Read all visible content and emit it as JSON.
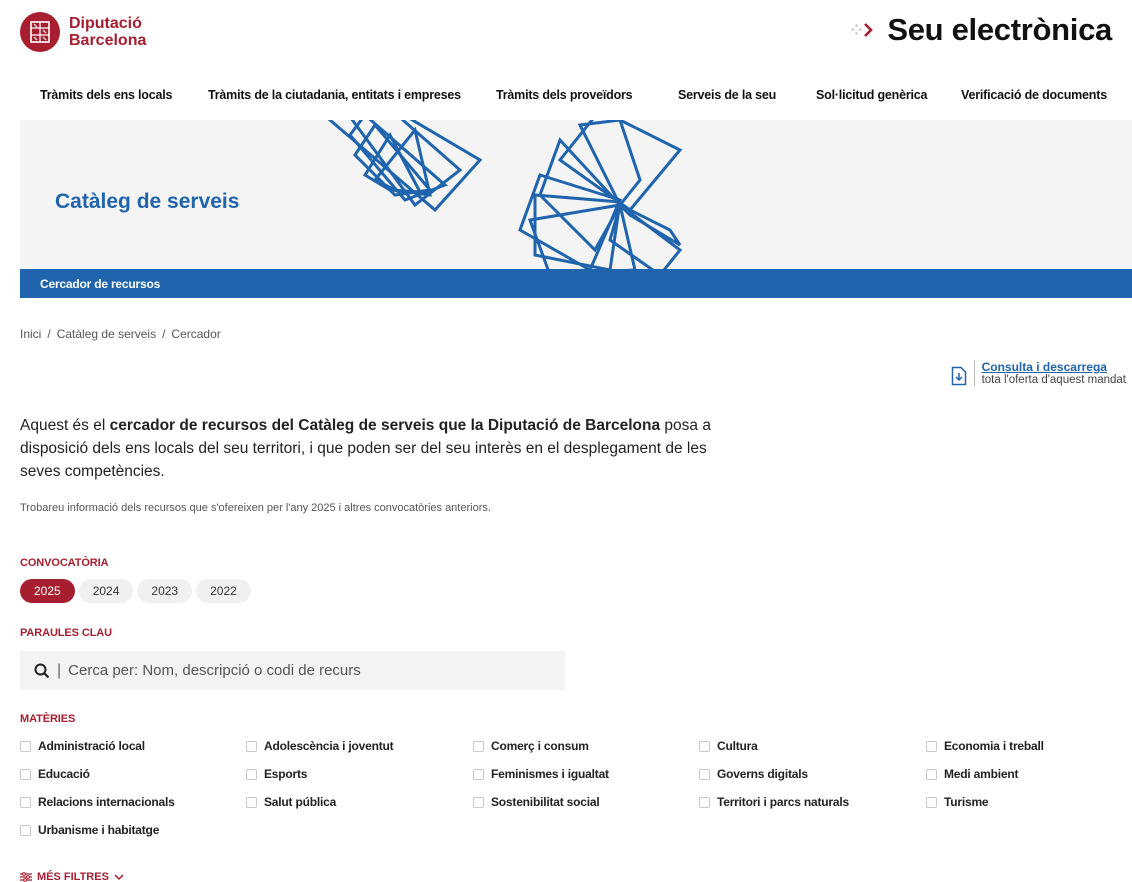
{
  "brand": {
    "line1": "Diputació",
    "line2": "Barcelona"
  },
  "seu": {
    "dots": "⁘",
    "title": "Seu electrònica"
  },
  "nav": [
    "Tràmits dels ens locals",
    "Tràmits de la ciutadania, entitats i empreses",
    "Tràmits dels proveïdors",
    "Serveis de la seu",
    "Sol·licitud genèrica",
    "Verificació de documents"
  ],
  "hero": {
    "title": "Catàleg de serveis",
    "bar_label": "Cercador de recursos"
  },
  "breadcrumb": {
    "items": [
      "Inici",
      "Catàleg de serveis",
      "Cercador"
    ],
    "separator": "/"
  },
  "download": {
    "link": "Consulta i descarrega",
    "sub": "tota l'oferta d'aquest mandat"
  },
  "intro": {
    "p1": "Aquest és el ",
    "bold": "cercador de recursos del Catàleg de serveis que la Diputació de Barcelona",
    "p2": " posa a disposició dels ens locals del seu territori, i que poden ser del seu interès en el desplegament de les seves competències.",
    "note": "Trobareu informació dels recursos que s'ofereixen per l'any 2025 i altres convocatòries anteriors."
  },
  "filters": {
    "convocatoria_label": "CONVOCATÒRIA",
    "years": [
      "2025",
      "2024",
      "2023",
      "2022"
    ],
    "selected_year": "2025",
    "keywords_label": "PARAULES CLAU",
    "search_placeholder": "Cerca per: Nom, descripció o codi de recurs",
    "search_value": "",
    "materies_label": "MATÈRIES",
    "materies": [
      "Administració local",
      "Adolescència i joventut",
      "Comerç i consum",
      "Cultura",
      "Economia i treball",
      "Educació",
      "Esports",
      "Feminismes i igualtat",
      "Governs digitals",
      "Medi ambient",
      "Relacions internacionals",
      "Salut pública",
      "Sostenibilitat social",
      "Territori i parcs naturals",
      "Turisme",
      "Urbanisme i habitatge"
    ],
    "more_label": "MÉS FILTRES"
  },
  "colors": {
    "brand_red": "#a61e2f",
    "brand_blue": "#1f64ad",
    "hero_bg": "#f4f4f4"
  },
  "icons": [
    "seal-icon",
    "chevron-right-icon",
    "download-document-icon",
    "search-icon",
    "filter-icon",
    "chevron-down-icon"
  ]
}
